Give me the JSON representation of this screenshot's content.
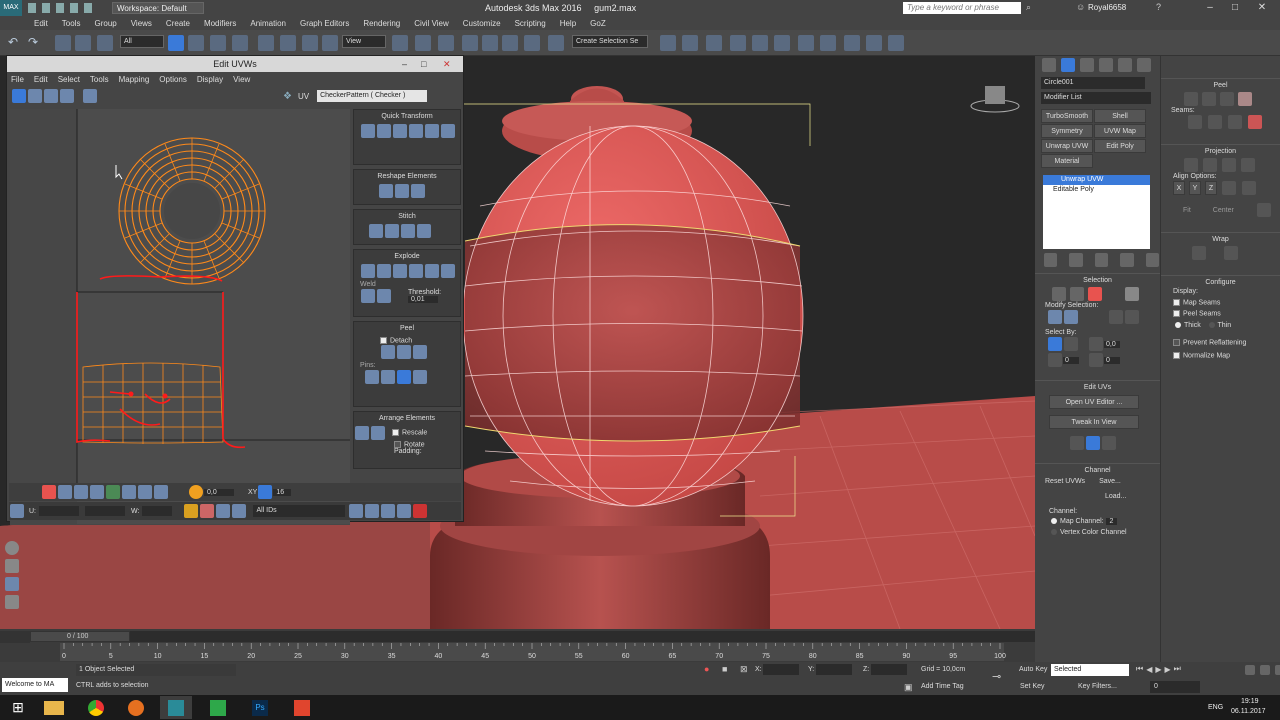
{
  "app": {
    "title": "Autodesk 3ds Max 2016",
    "file": "gum2.max",
    "workspace": "Workspace: Default",
    "search_placeholder": "Type a keyword or phrase",
    "user": "Royal6658"
  },
  "menu": [
    "Edit",
    "Tools",
    "Group",
    "Views",
    "Create",
    "Modifiers",
    "Animation",
    "Graph Editors",
    "Rendering",
    "Civil View",
    "Customize",
    "Scripting",
    "Help",
    "GoZ"
  ],
  "toolbar": {
    "filter": "All",
    "view": "View",
    "selection_set": "Create Selection Se"
  },
  "uvw": {
    "title": "Edit UVWs",
    "menu": [
      "File",
      "Edit",
      "Select",
      "Tools",
      "Mapping",
      "Options",
      "Display",
      "View"
    ],
    "uv_label": "UV",
    "checker": "CheckerPattern  ( Checker )",
    "quick_transform": "Quick Transform",
    "reshape": "Reshape Elements",
    "stitch": "Stitch",
    "explode": "Explode",
    "weld": "Weld",
    "threshold_label": "Threshold:",
    "threshold": "0,01",
    "peel": "Peel",
    "detach": "Detach",
    "pins": "Pins:",
    "arrange": "Arrange Elements",
    "rescale": "Rescale",
    "rotate": "Rotate",
    "padding": "Padding:",
    "spin_val": "0,0",
    "xy": "XY",
    "num16": "16",
    "u_label": "U:",
    "w_label": "W:",
    "all_ids": "All IDs"
  },
  "cmd": {
    "object_name": "Circle001",
    "modifier_list": "Modifier List",
    "buttons": [
      "TurboSmooth",
      "Shell",
      "Symmetry",
      "UVW Map",
      "Unwrap UVW",
      "Edit Poly",
      "Material"
    ],
    "stack": [
      "Unwrap UVW",
      "Editable Poly"
    ],
    "selection": "Selection",
    "modify_selection": "Modify Selection:",
    "select_by": "Select By:",
    "sel_val": "0,0",
    "sel_val2": "0",
    "sel_val3": "0",
    "edit_uvs": "Edit UVs",
    "open_uv_editor": "Open UV Editor ...",
    "tweak_in_view": "Tweak In View",
    "channel": "Channel",
    "reset_uvws": "Reset UVWs",
    "save": "Save...",
    "load": "Load...",
    "channel_label": "Channel:",
    "map_channel": "Map Channel:",
    "map_channel_val": "2",
    "vertex_color_channel": "Vertex Color Channel"
  },
  "cmd2": {
    "peel": "Peel",
    "seams": "Seams:",
    "projection": "Projection",
    "align_options": "Align Options:",
    "x": "X",
    "y": "Y",
    "z": "Z",
    "fit": "Fit",
    "center": "Center",
    "wrap": "Wrap",
    "configure": "Configure",
    "display": "Display:",
    "map_seams": "Map Seams",
    "peel_seams": "Peel Seams",
    "thick": "Thick",
    "thin": "Thin",
    "prevent_reflattening": "Prevent Reflattening",
    "normalize_map": "Normalize Map"
  },
  "timeline": {
    "frame": "0 / 100",
    "ticks": [
      "0",
      "5",
      "10",
      "15",
      "20",
      "25",
      "30",
      "35",
      "40",
      "45",
      "50",
      "55",
      "60",
      "65",
      "70",
      "75",
      "80",
      "85",
      "90",
      "95",
      "100"
    ]
  },
  "status": {
    "maxscript": "Welcome to MA",
    "selected": "1 Object Selected",
    "hint": "CTRL adds to selection",
    "x_label": "X:",
    "y_label": "Y:",
    "z_label": "Z:",
    "grid": "Grid = 10,0cm",
    "add_time_tag": "Add Time Tag",
    "auto_key": "Auto Key",
    "set_key": "Set Key",
    "selected_dd": "Selected",
    "key_filters": "Key Filters...",
    "frame_val": "0"
  },
  "taskbar": {
    "lang": "ENG",
    "time": "19:19",
    "date": "06.11.2017"
  },
  "colors": {
    "accent": "#e8534f",
    "uv_orange": "#ff8a1a",
    "seam_red": "#ff1a1a",
    "selection_blue": "#3a7ad9"
  }
}
